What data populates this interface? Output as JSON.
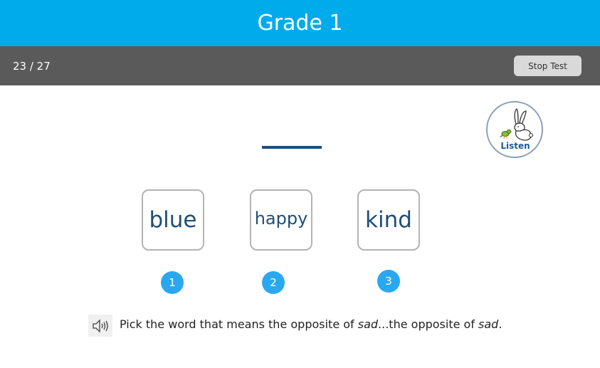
{
  "header": {
    "title": "Grade 1"
  },
  "status_bar": {
    "progress": "23 / 27",
    "stop_label": "Stop Test"
  },
  "listen": {
    "label": "Listen",
    "icon": "rabbit-bird-icon"
  },
  "question": {
    "choices": [
      {
        "word": "blue",
        "number": "1"
      },
      {
        "word": "happy",
        "number": "2"
      },
      {
        "word": "kind",
        "number": "3"
      }
    ],
    "prompt": {
      "part1": "Pick the word that means the opposite of ",
      "em1": "sad",
      "part2": "...the opposite of ",
      "em2": "sad",
      "part3": "."
    },
    "speaker_icon": "speaker-icon"
  },
  "colors": {
    "header_bg": "#00abeb",
    "status_bg": "#5a5a5a",
    "word_color": "#1f4e79",
    "number_bg": "#29a8f0"
  }
}
